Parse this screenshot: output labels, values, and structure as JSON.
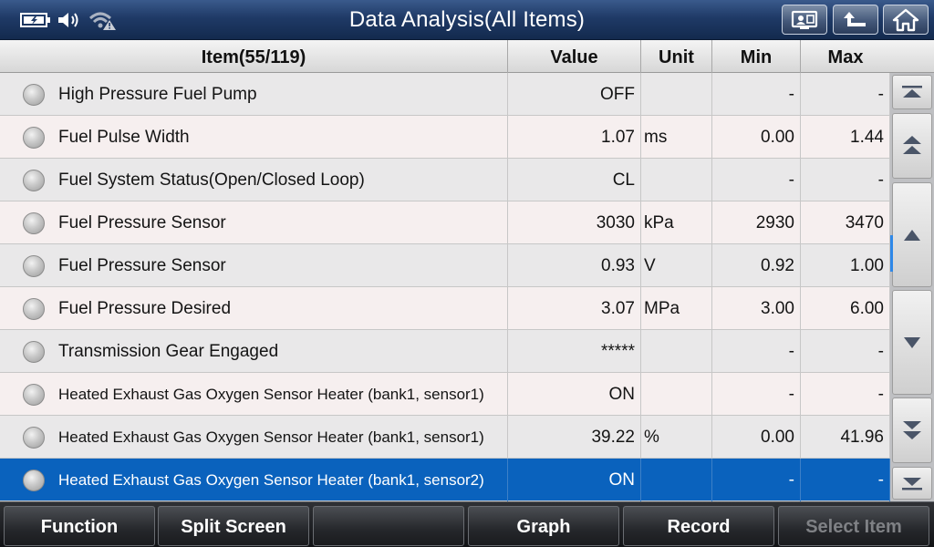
{
  "header": {
    "title": "Data Analysis(All Items)"
  },
  "table": {
    "columns": {
      "item": "Item(55/119)",
      "value": "Value",
      "unit": "Unit",
      "min": "Min",
      "max": "Max"
    },
    "rows": [
      {
        "item": "High Pressure Fuel Pump",
        "value": "OFF",
        "unit": "",
        "min": "-",
        "max": "-"
      },
      {
        "item": "Fuel Pulse Width",
        "value": "1.07",
        "unit": "ms",
        "min": "0.00",
        "max": "1.44"
      },
      {
        "item": "Fuel System Status(Open/Closed Loop)",
        "value": "CL",
        "unit": "",
        "min": "-",
        "max": "-"
      },
      {
        "item": "Fuel Pressure Sensor",
        "value": "3030",
        "unit": "kPa",
        "min": "2930",
        "max": "3470"
      },
      {
        "item": "Fuel Pressure Sensor",
        "value": "0.93",
        "unit": "V",
        "min": "0.92",
        "max": "1.00"
      },
      {
        "item": "Fuel Pressure Desired",
        "value": "3.07",
        "unit": "MPa",
        "min": "3.00",
        "max": "6.00"
      },
      {
        "item": "Transmission Gear Engaged",
        "value": "*****",
        "unit": "",
        "min": "-",
        "max": "-"
      },
      {
        "item": "Heated Exhaust Gas Oxygen Sensor Heater (bank1, sensor1)",
        "value": "ON",
        "unit": "",
        "min": "-",
        "max": "-"
      },
      {
        "item": "Heated Exhaust Gas Oxygen Sensor Heater (bank1, sensor1)",
        "value": "39.22",
        "unit": "%",
        "min": "0.00",
        "max": "41.96"
      },
      {
        "item": "Heated Exhaust Gas Oxygen Sensor Heater (bank1, sensor2)",
        "value": "ON",
        "unit": "",
        "min": "-",
        "max": "-"
      }
    ],
    "selected_row": 10
  },
  "toolbar": {
    "function": "Function",
    "split_screen": "Split Screen",
    "empty": "",
    "graph": "Graph",
    "record": "Record",
    "select_item": "Select Item"
  },
  "colors": {
    "title_bar": "#1f3a66",
    "selected_row": "#0a62bd",
    "scroll_indicator": "#2e88e8"
  },
  "icons": {
    "status": [
      "battery-icon",
      "speaker-icon",
      "wifi-warning-icon"
    ],
    "top_buttons": [
      "print-screen-icon",
      "back-arrow-icon",
      "home-icon"
    ],
    "scroll_buttons": [
      "scroll-to-top-icon",
      "page-up-icon",
      "line-up-icon",
      "line-down-icon",
      "page-down-icon",
      "scroll-to-bottom-icon"
    ]
  }
}
